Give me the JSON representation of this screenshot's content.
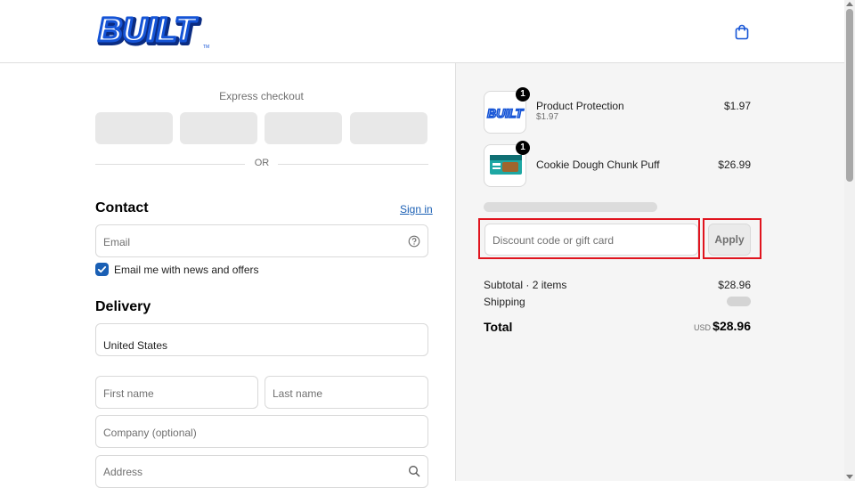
{
  "header": {
    "logo_text": "BUILT",
    "logo_tm": "TM",
    "colors": {
      "brand_blue": "#1554d6",
      "brand_dark": "#0b2c82"
    },
    "cart_icon": "shopping-bag-icon"
  },
  "checkout": {
    "express_label": "Express checkout",
    "or_label": "OR",
    "contact": {
      "title": "Contact",
      "sign_in": "Sign in",
      "email_placeholder": "Email",
      "news_label": "Email me with news and offers",
      "news_checked": true
    },
    "delivery": {
      "title": "Delivery",
      "country": "United States",
      "first_name_placeholder": "First name",
      "last_name_placeholder": "Last name",
      "company_placeholder": "Company (optional)",
      "address_placeholder": "Address"
    }
  },
  "summary": {
    "items": [
      {
        "name": "Product Protection",
        "sub": "$1.97",
        "price": "$1.97",
        "qty": "1"
      },
      {
        "name": "Cookie Dough Chunk Puff",
        "sub": "",
        "price": "$26.99",
        "qty": "1"
      }
    ],
    "discount_placeholder": "Discount code or gift card",
    "apply_label": "Apply",
    "subtotal_label": "Subtotal · 2 items",
    "subtotal_value": "$28.96",
    "shipping_label": "Shipping",
    "total_label": "Total",
    "total_currency": "USD",
    "total_value": "$28.96"
  }
}
